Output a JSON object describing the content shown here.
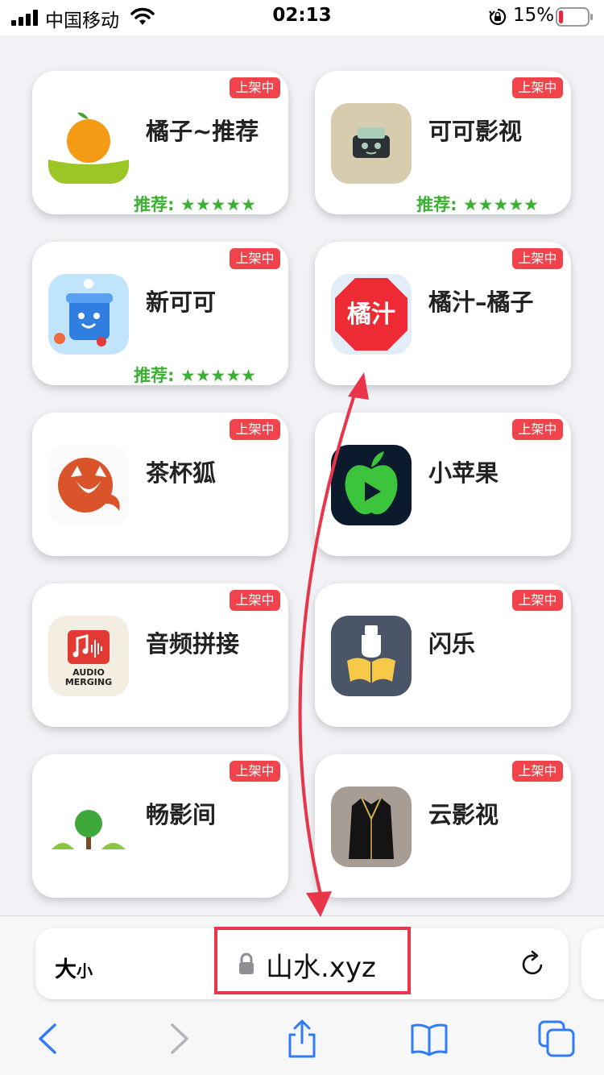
{
  "status_bar": {
    "carrier": "中国移动",
    "time": "02:13",
    "battery_percent": "15%",
    "battery_level": 0.15,
    "signal_icon": "signal-bars-icon",
    "wifi_icon": "wifi-icon",
    "orientation_lock_icon": "orientation-lock-icon"
  },
  "apps": [
    {
      "name": "橘子~推荐",
      "badge": "上架中",
      "rating": "推荐: ★★★★★",
      "icon": "orange-icon"
    },
    {
      "name": "可可影视",
      "badge": "上架中",
      "rating": "推荐: ★★★★★",
      "icon": "keke-tv-icon"
    },
    {
      "name": "新可可",
      "badge": "上架中",
      "rating": "推荐: ★★★★★",
      "icon": "cooler-box-icon"
    },
    {
      "name": "橘汁–橘子",
      "badge": "上架中",
      "icon": "juzhi-icon",
      "icon_text": "橘汁"
    },
    {
      "name": "茶杯狐",
      "badge": "上架中",
      "icon": "fox-icon"
    },
    {
      "name": "小苹果",
      "badge": "上架中",
      "icon": "green-apple-play-icon"
    },
    {
      "name": "音频拼接",
      "badge": "上架中",
      "icon": "audio-merging-icon",
      "icon_text_line1": "AUDIO",
      "icon_text_line2": "MERGING"
    },
    {
      "name": "闪乐",
      "badge": "上架中",
      "icon": "book-bottle-icon"
    },
    {
      "name": "畅影间",
      "badge": "上架中",
      "icon": "tree-icon"
    },
    {
      "name": "云影视",
      "badge": "上架中",
      "icon": "coat-icon"
    }
  ],
  "browser": {
    "text_size_big": "大",
    "text_size_small": "小",
    "url": "山水.xyz",
    "colors": {
      "accent": "#2f7cf6",
      "badge": "#f0434c",
      "rating": "#3cb034",
      "annotation": "#e8354a"
    }
  }
}
